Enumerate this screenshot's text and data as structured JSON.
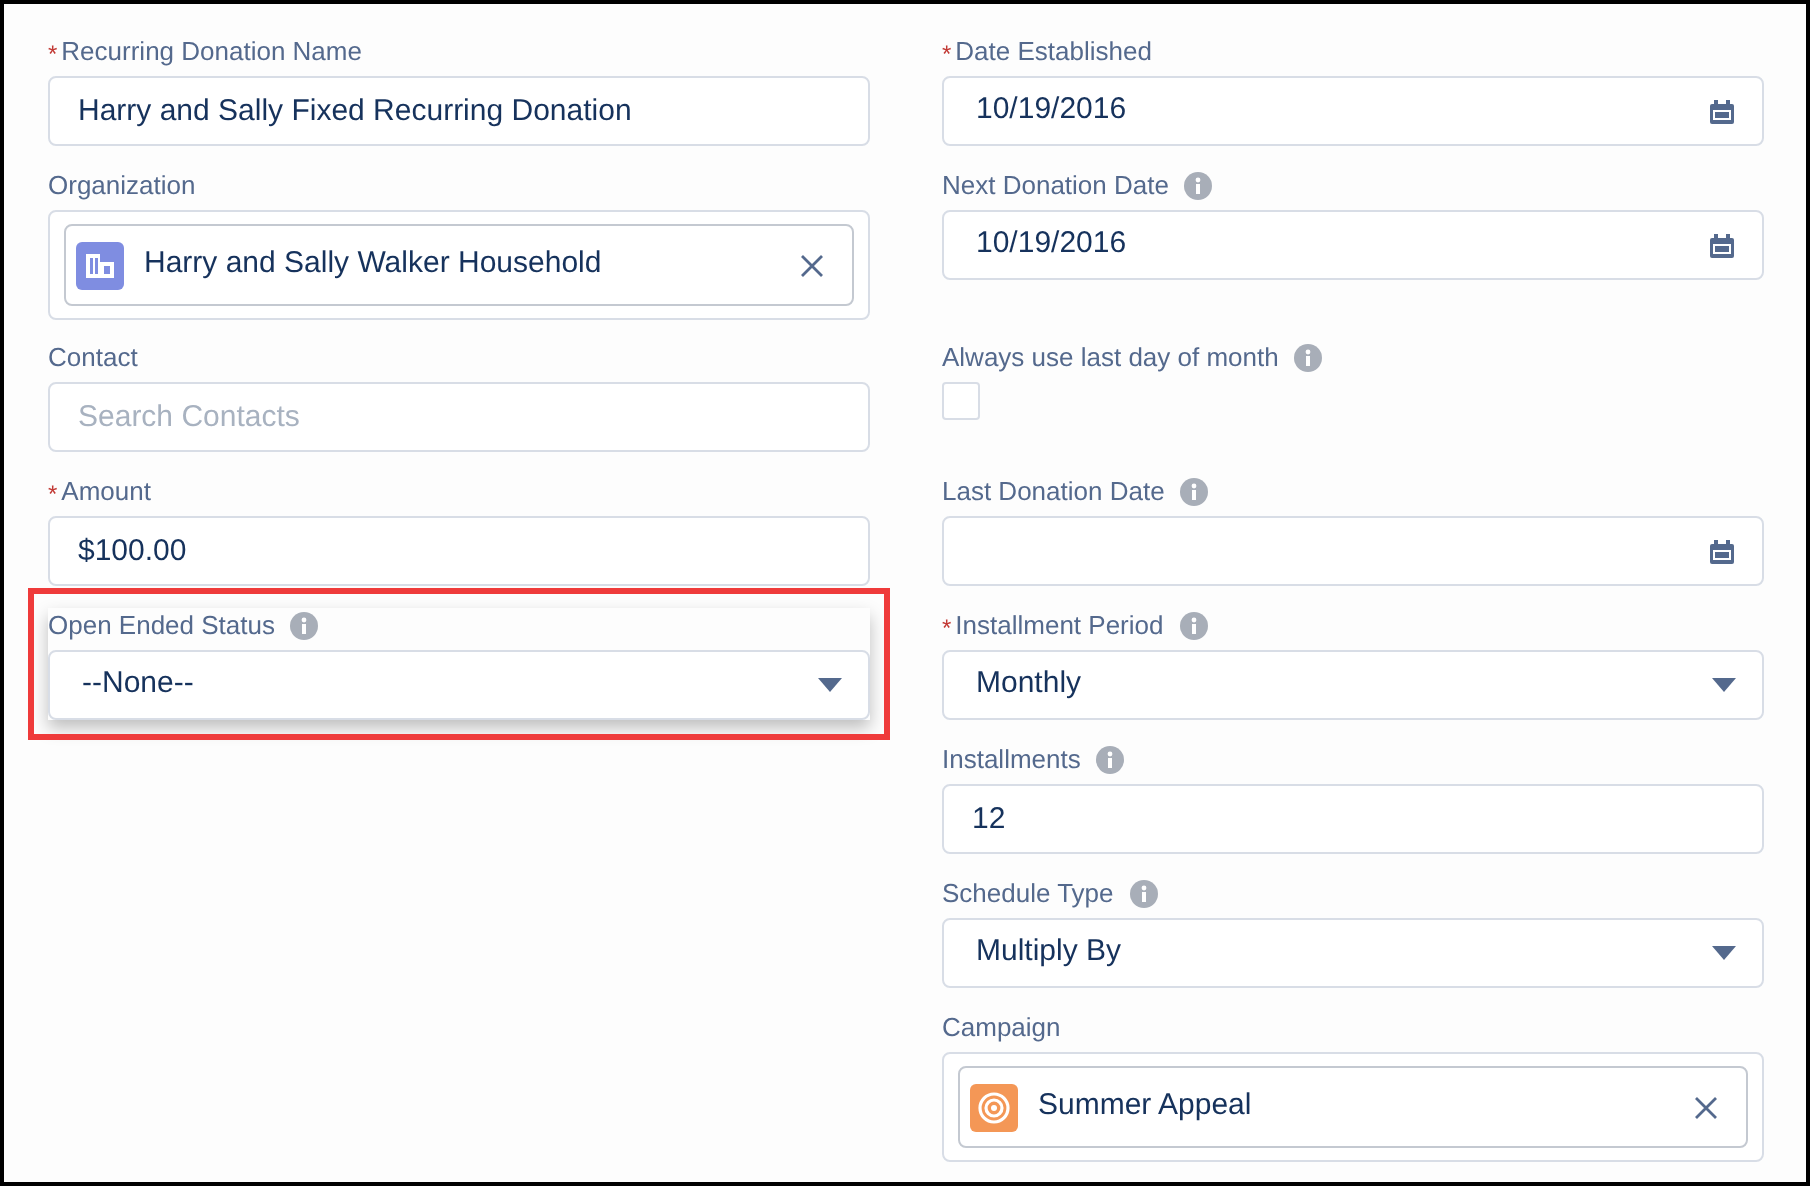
{
  "left_column": [
    {
      "kind": "text",
      "label": "Recurring Donation Name",
      "required_mark": "*",
      "info": false,
      "value": "Harry and Sally Fixed Recurring Donation"
    },
    {
      "kind": "lookup",
      "label": "Organization",
      "info": false,
      "value": "Harry and Sally Walker Household",
      "color": "#7f8de1"
    },
    {
      "kind": "text",
      "label": "Contact",
      "info": false,
      "placeholder": "Search Contacts"
    },
    {
      "kind": "text",
      "label": "Amount",
      "required_mark": "*",
      "info": false,
      "value": "$100.00"
    },
    {
      "kind": "picklist",
      "label": "Open Ended Status",
      "info": true,
      "value": "--None--",
      "highlighted": true
    }
  ],
  "right_column": [
    {
      "kind": "date",
      "label": "Date Established",
      "required_mark": "*",
      "info": false,
      "value": "10/19/2016"
    },
    {
      "kind": "date",
      "label": "Next Donation Date",
      "info": true,
      "value": "10/19/2016"
    },
    {
      "kind": "checkbox",
      "label": "Always use last day of month",
      "info": true,
      "checked": false
    },
    {
      "kind": "date",
      "label": "Last Donation Date",
      "info": true
    },
    {
      "kind": "picklist",
      "label": "Installment Period",
      "required_mark": "*",
      "info": true,
      "value": "Monthly"
    },
    {
      "kind": "text",
      "label": "Installments",
      "info": true,
      "value": "12"
    },
    {
      "kind": "picklist",
      "label": "Schedule Type",
      "info": true,
      "value": "Multiply By"
    },
    {
      "kind": "lookup",
      "label": "Campaign",
      "info": false,
      "value": "Summer Appeal",
      "color": "#f49756"
    }
  ]
}
